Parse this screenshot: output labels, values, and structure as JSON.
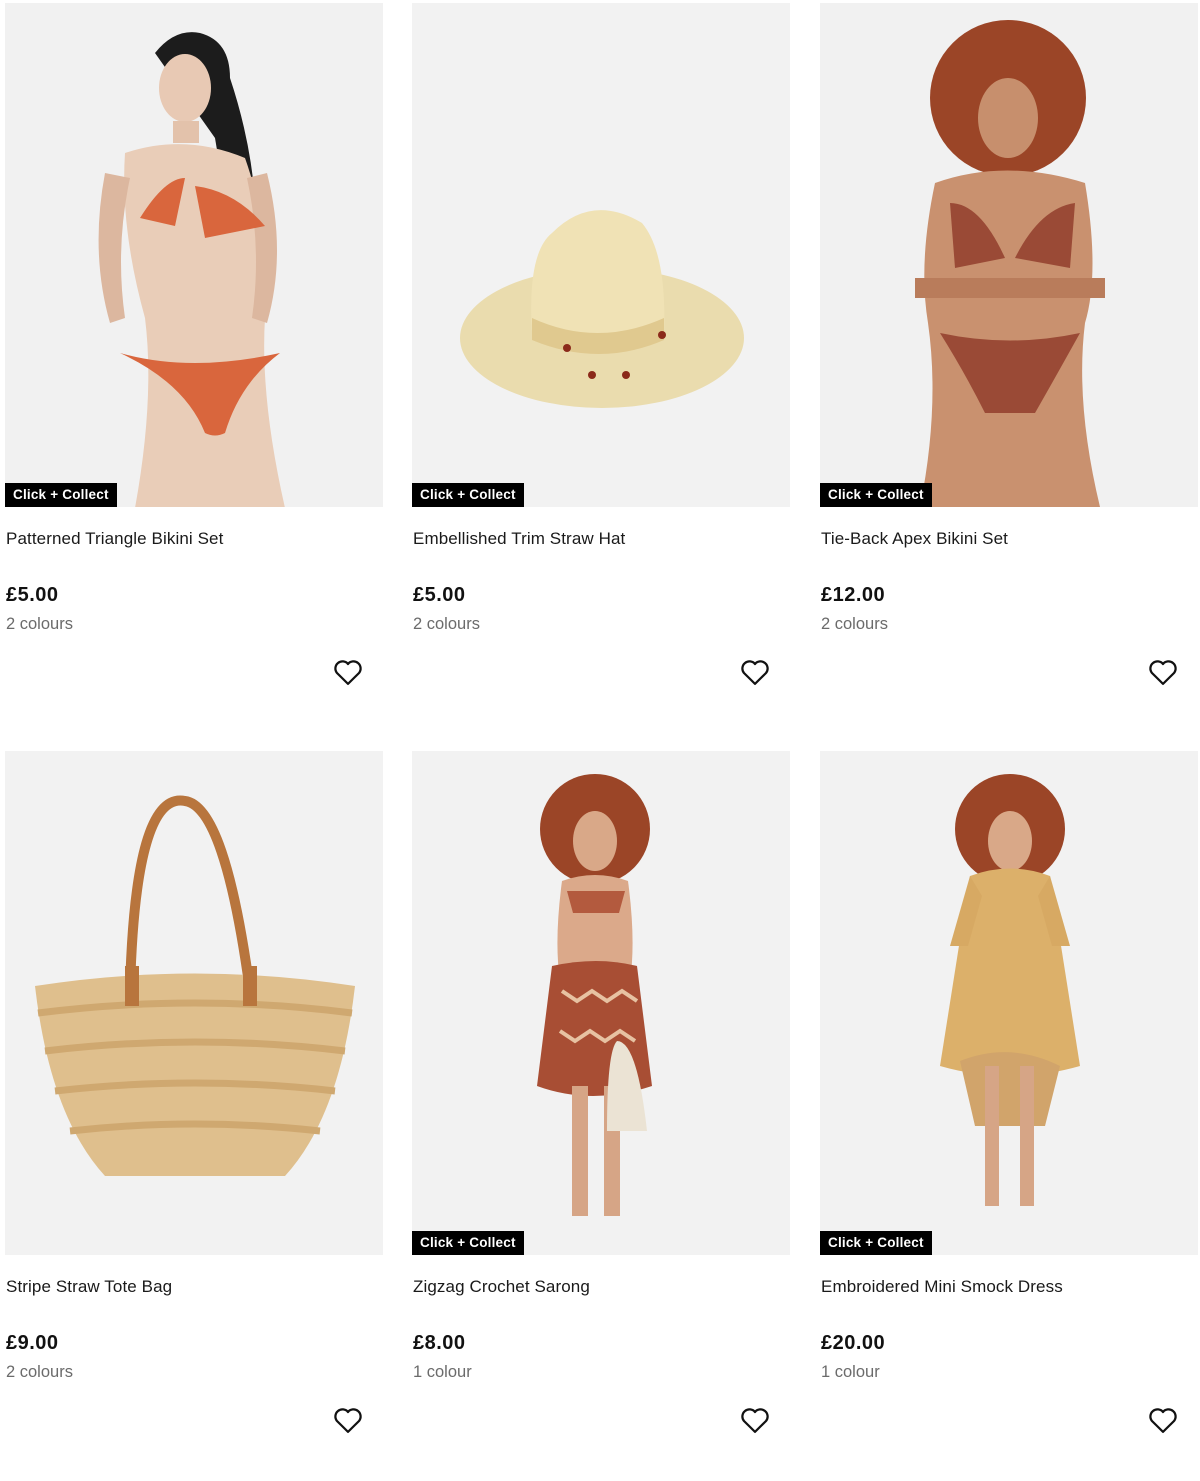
{
  "products": [
    {
      "name": "Patterned Triangle Bikini Set",
      "price": "£5.00",
      "colours": "2 colours",
      "badge": "Click + Collect",
      "image": "patterned-bikini-model-photo"
    },
    {
      "name": "Embellished Trim Straw Hat",
      "price": "£5.00",
      "colours": "2 colours",
      "badge": "Click + Collect",
      "image": "straw-hat-photo"
    },
    {
      "name": "Tie-Back Apex Bikini Set",
      "price": "£12.00",
      "colours": "2 colours",
      "badge": "Click + Collect",
      "image": "apex-bikini-model-photo"
    },
    {
      "name": "Stripe Straw Tote Bag",
      "price": "£9.00",
      "colours": "2 colours",
      "badge": "",
      "image": "straw-tote-bag-photo"
    },
    {
      "name": "Zigzag Crochet Sarong",
      "price": "£8.00",
      "colours": "1 colour",
      "badge": "Click + Collect",
      "image": "zigzag-sarong-model-photo"
    },
    {
      "name": "Embroidered Mini Smock Dress",
      "price": "£20.00",
      "colours": "1 colour",
      "badge": "Click + Collect",
      "image": "smock-dress-model-photo"
    }
  ],
  "icons": {
    "wishlist": "heart-outline-icon"
  },
  "colors": {
    "badge_bg": "#000000",
    "image_bg": "#f2f2f2",
    "muted_text": "#6b6b6b"
  }
}
